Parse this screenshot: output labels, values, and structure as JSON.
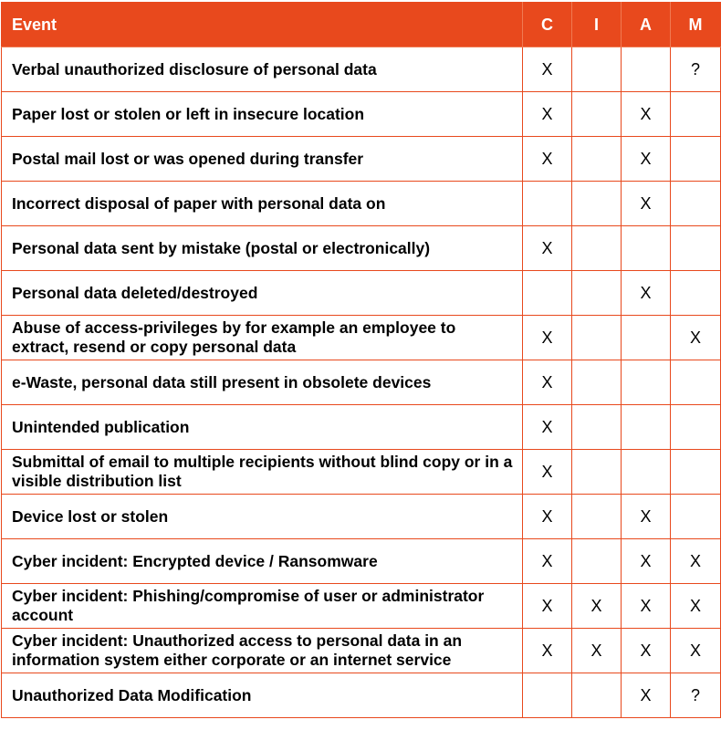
{
  "table": {
    "headers": [
      "Event",
      "C",
      "I",
      "A",
      "M"
    ],
    "rows": [
      {
        "event": "Verbal unauthorized disclosure of personal data",
        "c": "X",
        "i": "",
        "a": "",
        "m": "?"
      },
      {
        "event": "Paper lost or stolen or left in insecure location",
        "c": "X",
        "i": "",
        "a": "X",
        "m": ""
      },
      {
        "event": "Postal mail lost or was opened during transfer",
        "c": "X",
        "i": "",
        "a": "X",
        "m": ""
      },
      {
        "event": "Incorrect disposal of paper with personal data on",
        "c": "",
        "i": "",
        "a": "X",
        "m": ""
      },
      {
        "event": "Personal data sent by mistake (postal or electronically)",
        "c": "X",
        "i": "",
        "a": "",
        "m": ""
      },
      {
        "event": "Personal data deleted/destroyed",
        "c": "",
        "i": "",
        "a": "X",
        "m": ""
      },
      {
        "event": "Abuse of access-privileges by for example an employee to extract, resend or copy personal data",
        "c": "X",
        "i": "",
        "a": "",
        "m": "X"
      },
      {
        "event": "e-Waste, personal data still present in obsolete devices",
        "c": "X",
        "i": "",
        "a": "",
        "m": ""
      },
      {
        "event": "Unintended publication",
        "c": "X",
        "i": "",
        "a": "",
        "m": ""
      },
      {
        "event": "Submittal of email to multiple recipients without blind copy or in a visible distribution list",
        "c": "X",
        "i": "",
        "a": "",
        "m": ""
      },
      {
        "event": "Device lost or stolen",
        "c": "X",
        "i": "",
        "a": "X",
        "m": ""
      },
      {
        "event": "Cyber incident: Encrypted device / Ransomware",
        "c": "X",
        "i": "",
        "a": "X",
        "m": "X"
      },
      {
        "event": "Cyber incident: Phishing/compromise of user or administrator account",
        "c": "X",
        "i": "X",
        "a": "X",
        "m": "X"
      },
      {
        "event": "Cyber incident: Unauthorized access to personal data in an information system either corporate or an internet service",
        "c": "X",
        "i": "X",
        "a": "X",
        "m": "X"
      },
      {
        "event": "Unauthorized Data Modification",
        "c": "",
        "i": "",
        "a": "X",
        "m": "?"
      }
    ]
  },
  "colors": {
    "header_bg": "#E8491D",
    "border": "#E8491D",
    "header_text": "#FFFFFF"
  }
}
